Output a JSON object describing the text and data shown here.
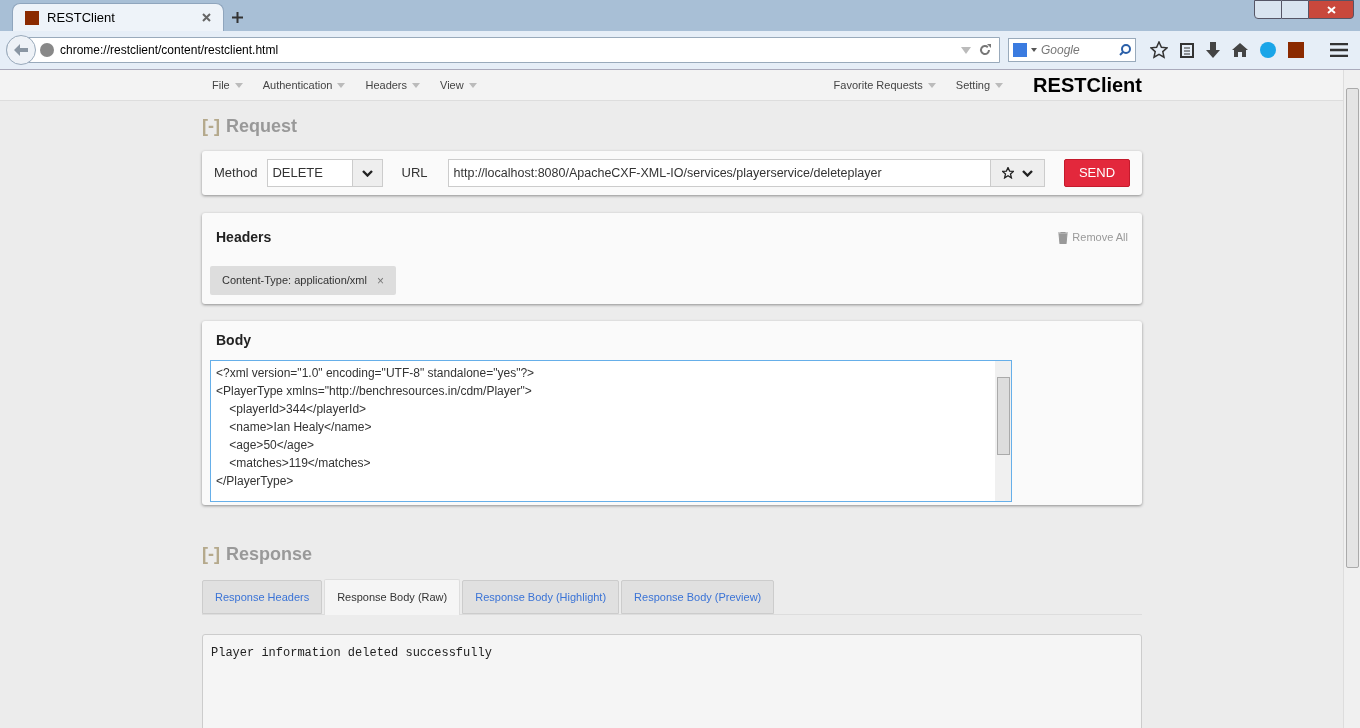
{
  "browser": {
    "tab_title": "RESTClient",
    "address": "chrome://restclient/content/restclient.html",
    "search_placeholder": "Google"
  },
  "menu": {
    "left": [
      "File",
      "Authentication",
      "Headers",
      "View"
    ],
    "right": [
      "Favorite Requests",
      "Setting"
    ],
    "brand": "RESTClient"
  },
  "request": {
    "toggle": "[-]",
    "title": "Request",
    "method_label": "Method",
    "method": "DELETE",
    "url_label": "URL",
    "url": "http://localhost:8080/ApacheCXF-XML-IO/services/playerservice/deleteplayer",
    "send": "SEND"
  },
  "headers": {
    "title": "Headers",
    "remove_all": "Remove All",
    "items": [
      "Content-Type: application/xml"
    ],
    "remove_glyph": "×"
  },
  "body": {
    "title": "Body",
    "text": "<?xml version=\"1.0\" encoding=\"UTF-8\" standalone=\"yes\"?>\n<PlayerType xmlns=\"http://benchresources.in/cdm/Player\">\n\t<playerId>344</playerId>\n\t<name>Ian Healy</name>\n\t<age>50</age>\n\t<matches>119</matches>\n</PlayerType>"
  },
  "response": {
    "toggle": "[-]",
    "title": "Response",
    "tabs": [
      {
        "label": "Response Headers",
        "selected": false
      },
      {
        "label": "Response Body (Raw)",
        "selected": true
      },
      {
        "label": "Response Body (Highlight)",
        "selected": false
      },
      {
        "label": "Response Body (Preview)",
        "selected": false
      }
    ],
    "output": "Player information deleted successfully"
  }
}
